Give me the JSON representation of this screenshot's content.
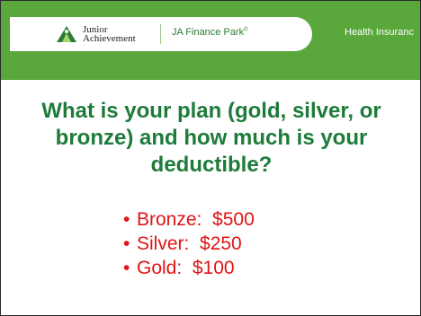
{
  "header": {
    "logo_line1": "Junior",
    "logo_line2": "Achievement",
    "park_name": "JA Finance Park",
    "park_mark": "®",
    "section_label": "Health Insuranc",
    "brand_color": "#5aa73c"
  },
  "question": {
    "text": "What is your plan (gold, silver, or bronze) and how much is your deductible?",
    "color": "#1e7b3a"
  },
  "options": {
    "bullet": "•",
    "color": "#e01414",
    "items": [
      {
        "label": "Bronze:  $500"
      },
      {
        "label": "Silver:  $250"
      },
      {
        "label": "Gold:  $100"
      }
    ]
  }
}
